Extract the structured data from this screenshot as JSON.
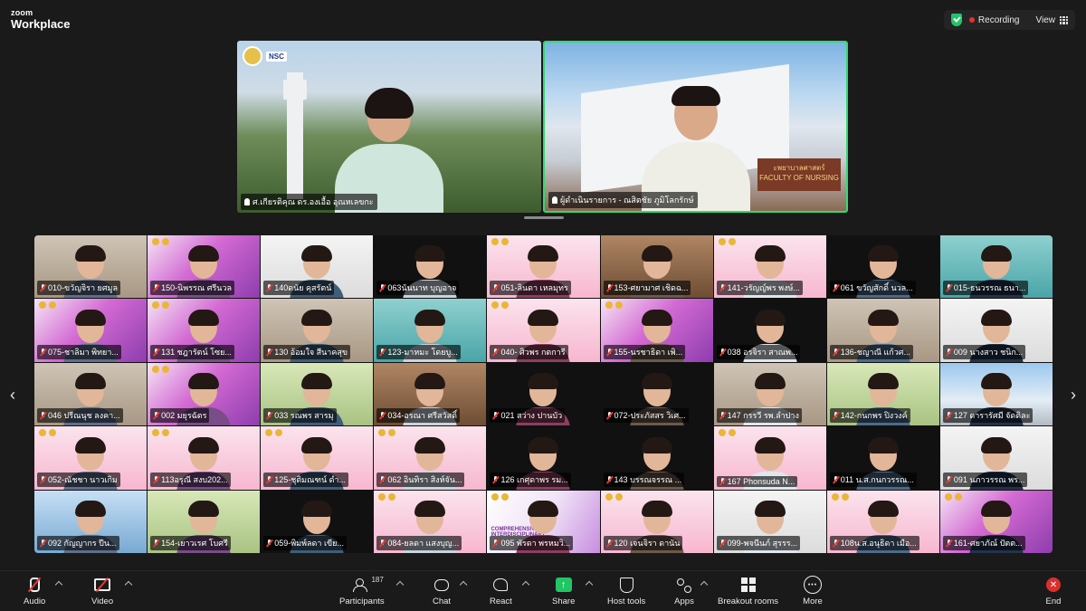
{
  "header": {
    "brand_line1": "zoom",
    "brand_line2": "Workplace",
    "recording_label": "Recording",
    "view_label": "View"
  },
  "speakers": [
    {
      "label": "ศ.เกียรติคุณ ดร.องเอื้อ อุณหเลขกะ"
    },
    {
      "label": "ผู้ดำเนินรายการ - ณสิตชัย ภูมิโลกรักษ์"
    }
  ],
  "speaker_logos": {
    "nsc": "NSC"
  },
  "building_sign": {
    "line1": "ะพยาบาลศาสตร์",
    "line2": "FACULTY OF NURSING"
  },
  "participants": [
    "010-ขวัญจิรา ยศมูล",
    "150-นิพรรณ ศรีนวล",
    "140ดนัย คุสรัตน์",
    "063นันนาท บุญอาจ",
    "051-ลินดา เหลมุทร",
    "153-ศยามาศ เชิดฉ...",
    "141-วรัญญ์พร พงษ์...",
    "061 ขวัญสักดิ์ นวล...",
    "015-ธนวรรณ ธนา...",
    "075-ชาลิมา พิทยา...",
    "131 ชฎารัตน์ โซย...",
    "130 อ้อมใจ สีนาคสุข",
    "123-มาหมะ โดยบู...",
    "040- ศิวพร กตการี",
    "155-นรชาธิดา เพิ...",
    "038 อรจิรา สาณพ...",
    "136-ชญาณี แก้วศ...",
    "009 นางสาว ชนิก...",
    "046 ปรีณนุช ลงคา...",
    "002 มยุรฉัตร",
    "033 รณพร สารมุ",
    "034-อรณา ศรีสวัสดิ์",
    "021 สว่าง ปานบัว",
    "072-ประภัสสร วิเศ...",
    "147 กรรวี รพ.ลำปาง",
    "142-กนกพร ปิงวงค์",
    "127 ดารารัศมี จัดดิละ",
    "052-ณัชชา นาวเกิม",
    "113อรุณี สงบ202...",
    "125-ชุติมณฑน์ ดำ...",
    "062 อินทิรา สิงห์จัน...",
    "126 เกศุดาพร รม...",
    "143 บรรณจรรณ ...",
    "167 Phonsuda N...",
    "011 น.ส.กนกวรรณ...",
    "091 นภาวรรณ พร...",
    "092 กัญญากร ปีน...",
    "154-เยาวเรศ โบศรี",
    "059-พิมพ์ลดา เขีย...",
    "084-ยลดา แสงบุญ...",
    "095 พัรดา พรหมวิ...",
    "120 เจนจิรา ดานัน",
    "099-พจนีนภ์ สุรรร...",
    "108น.ส.อนุธิดา เมือ...",
    "161-ศยาภัณ์ ปัตต..."
  ],
  "comprehensive_text": {
    "line1": "COMPREHENSIVE",
    "line2": "INTERDISCIPLINARY"
  },
  "toolbar": {
    "audio": "Audio",
    "video": "Video",
    "participants": "Participants",
    "participants_count": "187",
    "chat": "Chat",
    "react": "React",
    "share": "Share",
    "host_tools": "Host tools",
    "apps": "Apps",
    "breakout": "Breakout rooms",
    "more": "More",
    "end": "End"
  },
  "colors": {
    "active_speaker_border": "#2fdc6e",
    "share_green": "#22c564",
    "end_red": "#d9302c",
    "recording_red": "#e5322d"
  }
}
